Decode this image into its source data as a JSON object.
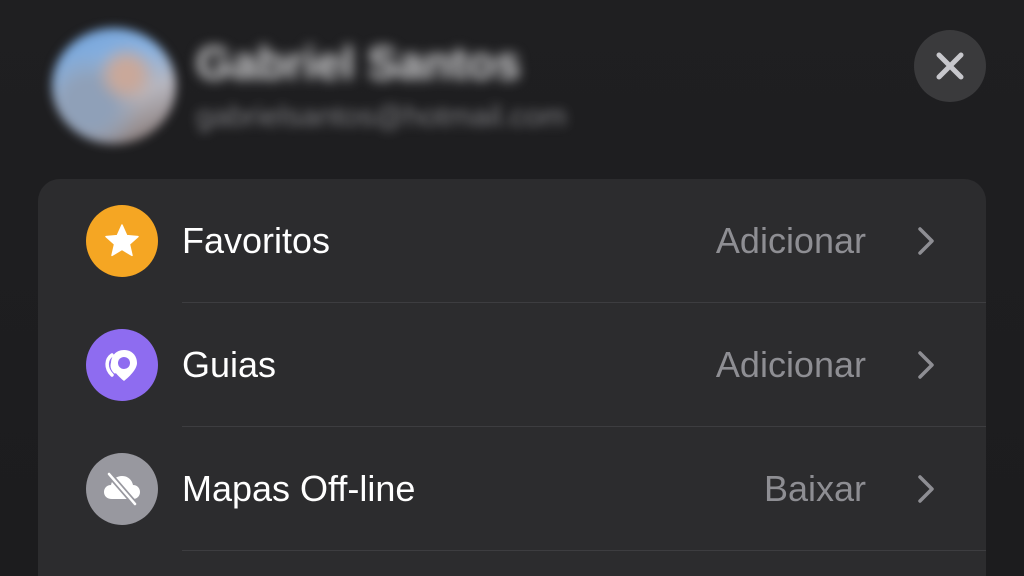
{
  "header": {
    "user_name": "Gabriel Santos",
    "user_email": "gabrielsantos@hotmail.com",
    "close_icon": "close-icon"
  },
  "list": {
    "items": [
      {
        "label": "Favoritos",
        "action": "Adicionar",
        "icon": "star-icon",
        "icon_color": "#f5a623"
      },
      {
        "label": "Guias",
        "action": "Adicionar",
        "icon": "guides-icon",
        "icon_color": "#8e6cf0"
      },
      {
        "label": "Mapas Off-line",
        "action": "Baixar",
        "icon": "cloud-offline-icon",
        "icon_color": "#98989f"
      }
    ]
  },
  "colors": {
    "background": "#1c1c1e",
    "card": "#2c2c2e",
    "secondary_text": "#8e8e93"
  }
}
